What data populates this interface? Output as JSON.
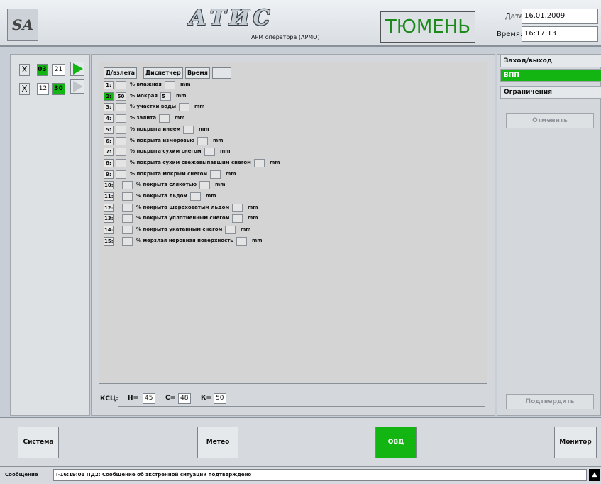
{
  "header": {
    "logo": "SA",
    "app_title": "АТИС",
    "app_subtitle": "АРМ оператора (АРМО)",
    "city": "ТЮМЕНЬ",
    "date_label": "Дата:",
    "date_value": "16.01.2009",
    "time_label": "Время:",
    "time_value": "16:17:13"
  },
  "left_panel": {
    "row1": {
      "x": "X",
      "a": "03",
      "b": "21"
    },
    "row2": {
      "x": "X",
      "a": "12",
      "b": "30"
    }
  },
  "center": {
    "header": {
      "col1": "Д/взлета",
      "col2": "Диспетчер",
      "col3": "Время"
    },
    "rows": [
      {
        "num": "1:",
        "pct": "",
        "desc": "% влажная",
        "val": "",
        "unit": "mm"
      },
      {
        "num": "2:",
        "pct": "50",
        "desc": "% мокрая",
        "val": "5",
        "unit": "mm"
      },
      {
        "num": "3:",
        "pct": "",
        "desc": "% участки воды",
        "val": "",
        "unit": "mm"
      },
      {
        "num": "4:",
        "pct": "",
        "desc": "% залита",
        "val": "",
        "unit": "mm"
      },
      {
        "num": "5:",
        "pct": "",
        "desc": "% покрыта инеем",
        "val": "",
        "unit": "mm"
      },
      {
        "num": "6:",
        "pct": "",
        "desc": "% покрыта изморозью",
        "val": "",
        "unit": "mm"
      },
      {
        "num": "7:",
        "pct": "",
        "desc": "% покрыта сухим снегом",
        "val": "",
        "unit": "mm"
      },
      {
        "num": "8:",
        "pct": "",
        "desc": "% покрыта сухим свежевыпавшим снегом",
        "val": "",
        "unit": "mm"
      },
      {
        "num": "9:",
        "pct": "",
        "desc": "% покрыта мокрым снегом",
        "val": "",
        "unit": "mm"
      },
      {
        "num": "10:",
        "pct": "",
        "desc": "% покрыта слякотью",
        "val": "",
        "unit": "mm"
      },
      {
        "num": "11:",
        "pct": "",
        "desc": "% покрыта льдом",
        "val": "",
        "unit": "mm"
      },
      {
        "num": "12:",
        "pct": "",
        "desc": "% покрыта шероховатым льдом",
        "val": "",
        "unit": "mm"
      },
      {
        "num": "13:",
        "pct": "",
        "desc": "% покрыта уплотненным снегом",
        "val": "",
        "unit": "mm"
      },
      {
        "num": "14:",
        "pct": "",
        "desc": "% покрыта укатанным снегом",
        "val": "",
        "unit": "mm"
      },
      {
        "num": "15:",
        "pct": "",
        "desc": "% мерзлая неровная поверхность",
        "val": "",
        "unit": "mm"
      }
    ],
    "ksc": {
      "label": "КСЦ:",
      "h_label": "Н=",
      "h": "45",
      "c_label": "С=",
      "c": "48",
      "k_label": "К=",
      "k": "50"
    }
  },
  "right_panel": {
    "items": [
      "Заход/выход",
      "ВПП",
      "Ограничения"
    ],
    "cancel": "Отменить",
    "confirm": "Подтвердить"
  },
  "bottom": {
    "system": "Система",
    "meteo": "Метео",
    "ovd": "ОВД",
    "monitor": "Монитор"
  },
  "status": {
    "label": "Сообщение",
    "text": "I-16:19:01 ПД2: Сообщение об экстренной ситуации подтверждено",
    "arrow": "▲"
  },
  "colors": {
    "accent_green": "#12b512",
    "city_text": "#1b8a1b"
  }
}
